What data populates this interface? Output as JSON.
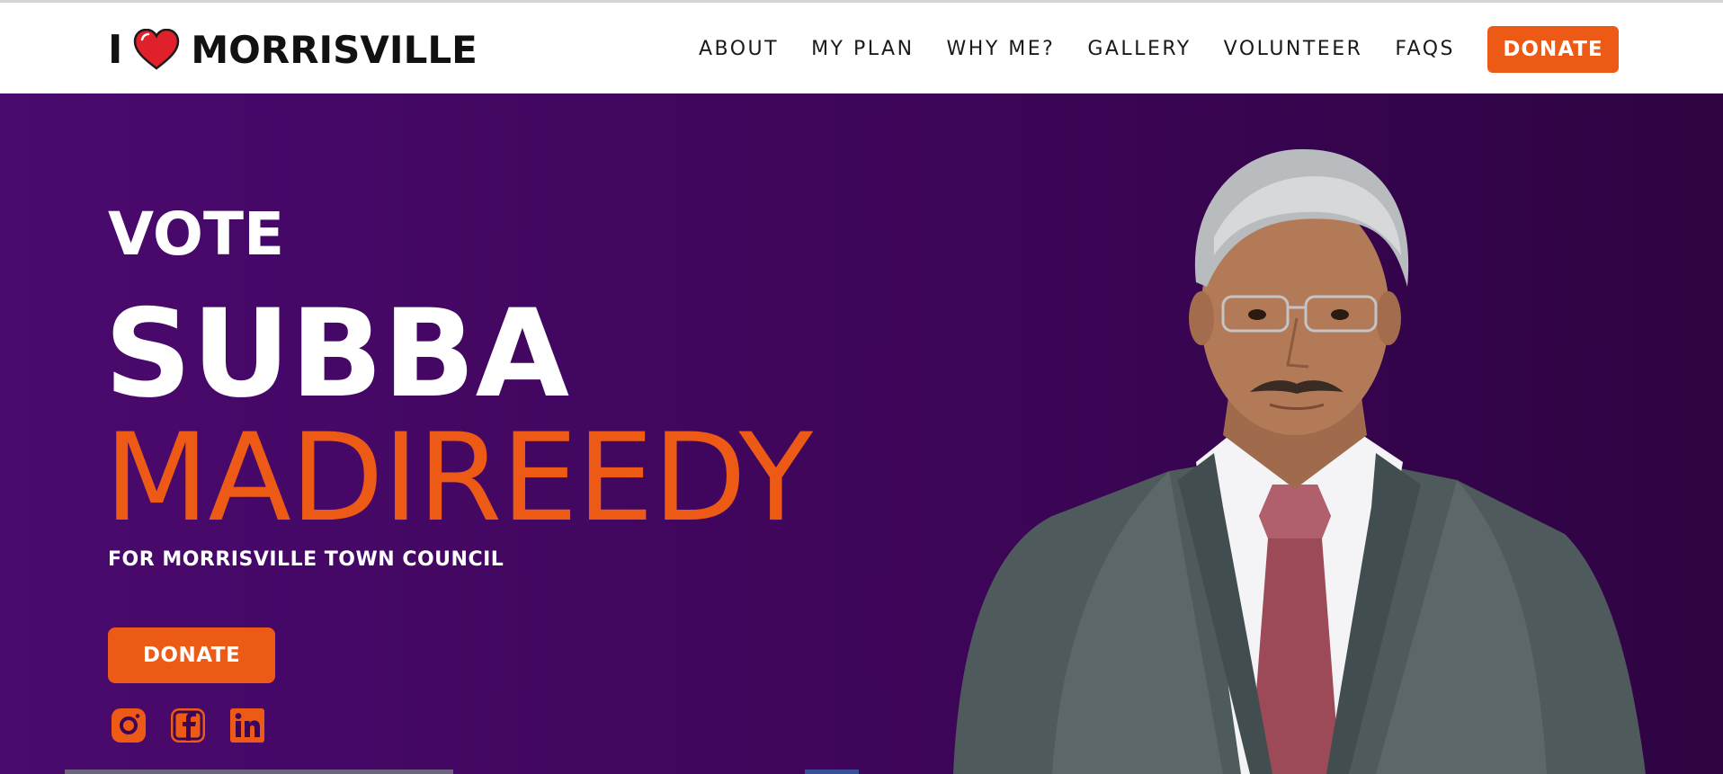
{
  "brand": {
    "prefix": "I",
    "heart_icon": "heart-icon",
    "name": "MORRISVILLE"
  },
  "nav": {
    "items": [
      "ABOUT",
      "MY PLAN",
      "WHY ME?",
      "GALLERY",
      "VOLUNTEER",
      "FAQS"
    ],
    "donate_label": "DONATE"
  },
  "hero": {
    "vote": "VOTE",
    "first_name": "SUBBA",
    "last_name": "MADIREEDY",
    "subtitle": "FOR MORRISVILLE TOWN COUNCIL",
    "donate_label": "DONATE",
    "socials": [
      "instagram-icon",
      "facebook-icon",
      "linkedin-icon"
    ],
    "portrait": "candidate-portrait"
  },
  "colors": {
    "accent": "#ec5a16",
    "hero_bg_start": "#4a0a6e",
    "hero_bg_end": "#2e0442",
    "heart": "#e0202a"
  }
}
